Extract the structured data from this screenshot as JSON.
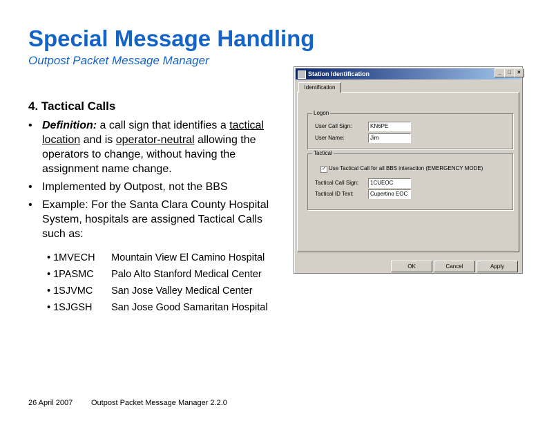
{
  "title": "Special Message Handling",
  "subtitle": "Outpost Packet Message Manager",
  "section_heading": "4. Tactical Calls",
  "bullets": {
    "b1": {
      "label": "Definition:",
      "pre": " a call sign that identifies a ",
      "u1": "tactical location",
      "mid": " and is ",
      "u2": "operator-neutral",
      "post": " allowing the operators to change, without having the assignment name change."
    },
    "b2": "Implemented by Outpost, not the BBS",
    "b3": "Example: For the Santa Clara County Hospital System, hospitals are assigned Tactical Calls such as:"
  },
  "bullet_glyph": "•",
  "examples": [
    {
      "code": "1MVECH",
      "name": "Mountain View El Camino Hospital"
    },
    {
      "code": "1PASMC",
      "name": "Palo Alto Stanford Medical Center"
    },
    {
      "code": "1SJVMC",
      "name": "San Jose Valley Medical Center"
    },
    {
      "code": "1SJGSH",
      "name": "San Jose Good Samaritan Hospital"
    }
  ],
  "footer": {
    "date": "26 April 2007",
    "title": "Outpost Packet Message Manager 2.2.0"
  },
  "dialog": {
    "title": "Station Identification",
    "tab": "Identification",
    "group_logon": "Logon",
    "user_call_sign_label": "User Call Sign:",
    "user_call_sign_value": "KN6PE",
    "user_name_label": "User Name:",
    "user_name_value": "Jim",
    "group_tactical": "Tactical",
    "checkbox_label": "Use Tactical Call for all BBS interaction (EMERGENCY MODE)",
    "tactical_call_label": "Tactical Call Sign:",
    "tactical_call_value": "1CUEOC",
    "tactical_id_label": "Tactical ID Text:",
    "tactical_id_value": "Cupertino EOC",
    "buttons": {
      "ok": "OK",
      "cancel": "Cancel",
      "apply": "Apply"
    },
    "controls": {
      "minimize": "_",
      "maximize": "□",
      "close": "×"
    }
  },
  "colors": {
    "title_blue": "#1464c8"
  }
}
